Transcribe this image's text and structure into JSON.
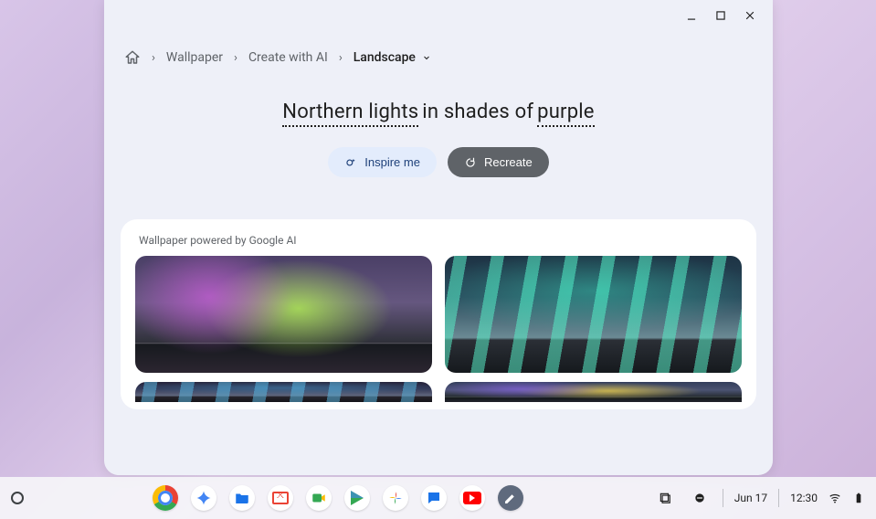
{
  "window_controls": {
    "minimize": "—",
    "maximize": "▢",
    "close": "✕"
  },
  "breadcrumb": {
    "home_label": "Home",
    "items": [
      "Wallpaper",
      "Create with AI"
    ],
    "current": "Landscape"
  },
  "prompt": {
    "gap1": "Northern lights",
    "mid": " in shades of ",
    "gap2": "purple"
  },
  "actions": {
    "inspire": "Inspire me",
    "recreate": "Recreate"
  },
  "card": {
    "label": "Wallpaper powered by Google AI"
  },
  "shelf": {
    "apps": [
      "chrome",
      "gemini",
      "files",
      "gmail",
      "meet",
      "play",
      "photos",
      "messages",
      "youtube",
      "canvas"
    ]
  },
  "tray": {
    "date": "Jun 17",
    "time": "12:30"
  }
}
